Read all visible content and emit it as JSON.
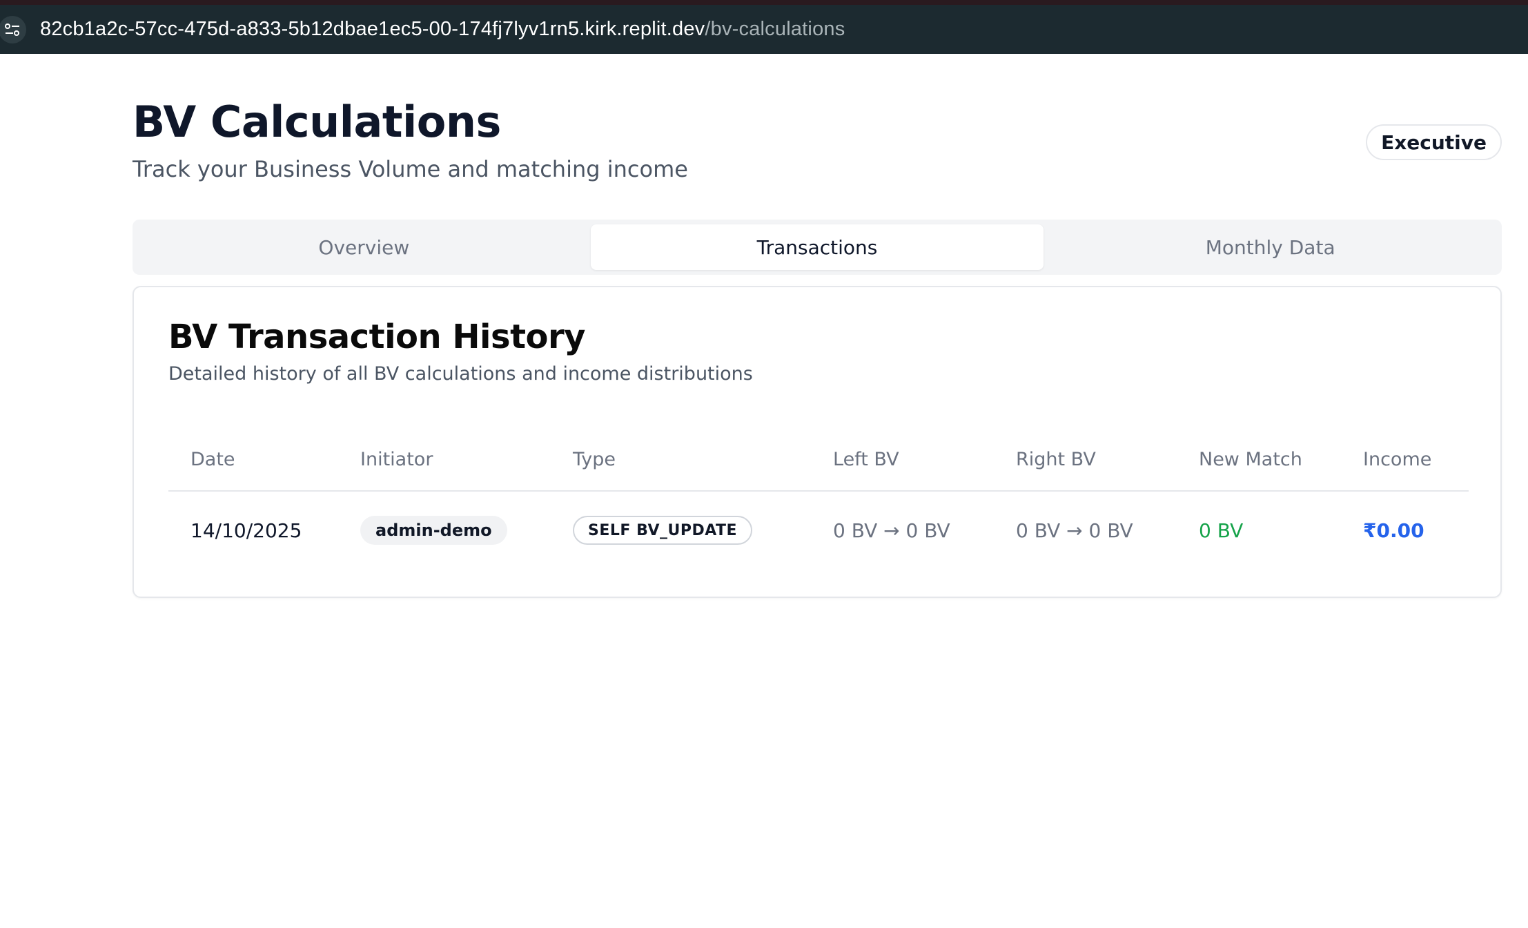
{
  "browser": {
    "url_host": "82cb1a2c-57cc-475d-a833-5b12dbae1ec5-00-174fj7lyv1rn5.kirk.replit.dev",
    "url_path": "/bv-calculations"
  },
  "page": {
    "title": "BV Calculations",
    "subtitle": "Track your Business Volume and matching income",
    "rank_badge": "Executive"
  },
  "tabs": [
    {
      "label": "Overview",
      "active": false
    },
    {
      "label": "Transactions",
      "active": true
    },
    {
      "label": "Monthly Data",
      "active": false
    }
  ],
  "card": {
    "title": "BV Transaction History",
    "subtitle": "Detailed history of all BV calculations and income distributions"
  },
  "table": {
    "columns": [
      "Date",
      "Initiator",
      "Type",
      "Left BV",
      "Right BV",
      "New Match",
      "Income"
    ],
    "rows": [
      {
        "date": "14/10/2025",
        "initiator": "admin-demo",
        "type": "SELF BV_UPDATE",
        "left_bv": "0 BV → 0 BV",
        "right_bv": "0 BV → 0 BV",
        "new_match": "0 BV",
        "income": "₹0.00"
      }
    ]
  },
  "colors": {
    "browser_bar": "#1c2a30",
    "match_green": "#16a34a",
    "income_blue": "#2563eb"
  },
  "icons": {
    "site_settings": "site-settings-icon"
  }
}
